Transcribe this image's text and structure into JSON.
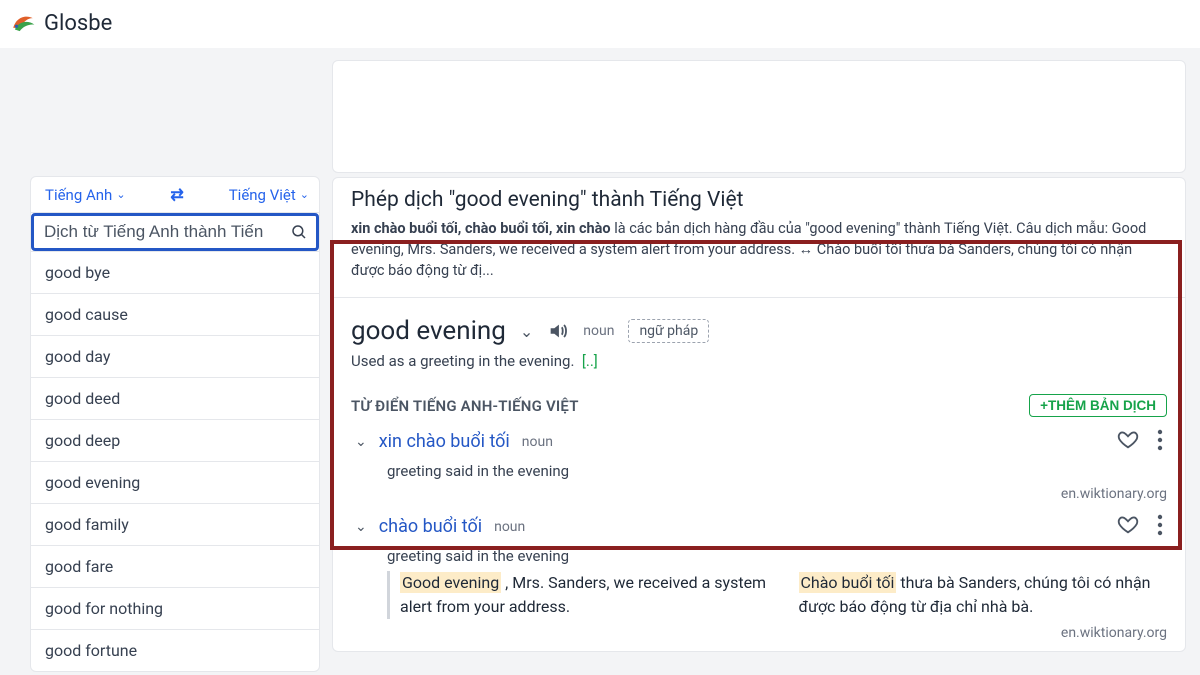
{
  "brand": "Glosbe",
  "sidebar": {
    "lang_from": "Tiếng Anh",
    "lang_to": "Tiếng Việt",
    "search_placeholder": "Dịch từ Tiếng Anh thành Tiến",
    "suggestions": [
      "good bye",
      "good cause",
      "good day",
      "good deed",
      "good deep",
      "good evening",
      "good family",
      "good fare",
      "good for nothing",
      "good fortune"
    ]
  },
  "content": {
    "title": "Phép dịch \"good evening\" thành Tiếng Việt",
    "summary_bold": "xin chào buổi tối, chào buổi tối, xin chào",
    "summary_rest": " là các bản dịch hàng đầu của \"good evening\" thành Tiếng Việt. Câu dịch mẫu: Good evening, Mrs. Sanders, we received a system alert from your address. ↔ Chào buổi tối thưa bà Sanders, chúng tôi có nhận được báo động từ đị...",
    "entry_word": "good evening",
    "pos": "noun",
    "grammar_pill": "ngữ pháp",
    "definition": "Used as a greeting in the evening.",
    "ellipsis": "[..]",
    "dict_header": "TỪ ĐIỂN TIẾNG ANH-TIẾNG VIỆT",
    "add_button": "+THÊM BẢN DỊCH",
    "translations": [
      {
        "word": "xin chào buổi tối",
        "pos": "noun",
        "gloss": "greeting said in the evening",
        "source": "en.wiktionary.org"
      },
      {
        "word": "chào buổi tối",
        "pos": "noun",
        "gloss": "greeting said in the evening",
        "source": "en.wiktionary.org"
      }
    ],
    "example": {
      "en_pre": "Good",
      "en_hl": "evening",
      "en_post": " , Mrs. Sanders, we received a system alert from your address.",
      "vi_hl": "Chào buổi tối",
      "vi_post": " thưa bà Sanders, chúng tôi có nhận được báo động từ địa chỉ nhà bà."
    }
  }
}
